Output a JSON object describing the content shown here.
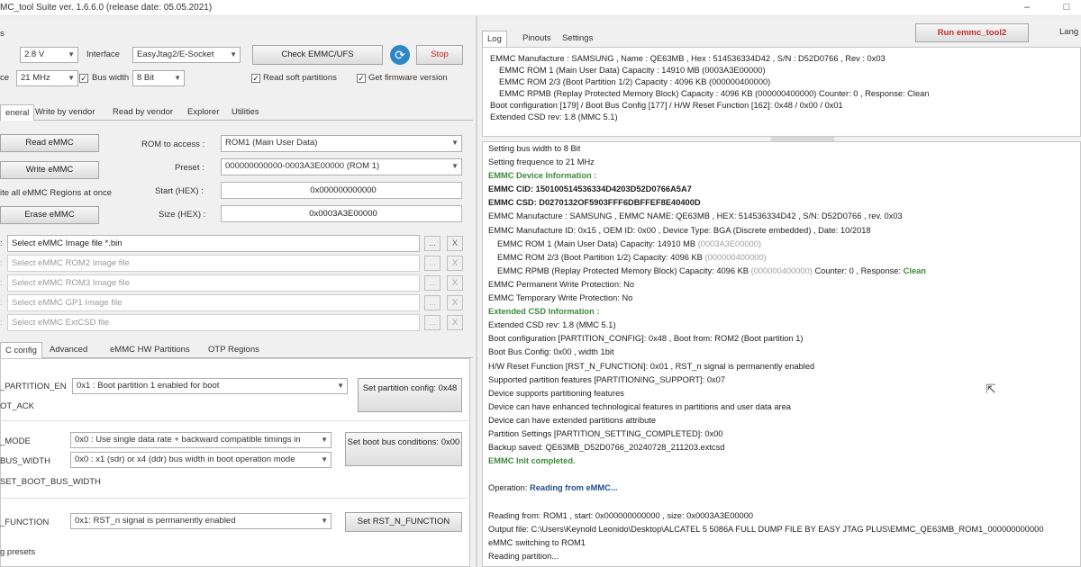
{
  "window": {
    "title": "MC_tool Suite  ver. 1.6.6.0 (release date: 05.05.2021)",
    "minimize": "–",
    "maximize": "□"
  },
  "top_controls": {
    "voltage": "2.8 V",
    "interface_label": "Interface",
    "interface_value": "EasyJtag2/E-Socket",
    "freq_label": "ce",
    "freq": "21 MHz",
    "bus_width_label": "Bus width",
    "bus_width": "8 Bit",
    "check_button": "Check EMMC/UFS",
    "stop_button": "Stop",
    "read_soft_partitions": "Read soft partitions",
    "get_firmware": "Get firmware version"
  },
  "main_tabs": [
    "eneral",
    "Write by vendor",
    "Read by vendor",
    "Explorer",
    "Utilities"
  ],
  "general": {
    "read_button": "Read eMMC",
    "write_button": "Write eMMC",
    "write_all_label": "ite all eMMC Regions at once",
    "erase_button": "Erase eMMC",
    "rom_label": "ROM to access :",
    "rom_value": "ROM1 (Main User Data)",
    "preset_label": "Preset :",
    "preset_value": "000000000000-0003A3E00000 (ROM 1)",
    "start_label": "Start (HEX) :",
    "start_value": "0x000000000000",
    "size_label": "Size (HEX) :",
    "size_value": "0x0003A3E00000",
    "files": [
      "Select eMMC Image file *.bin",
      "Select eMMC ROM2 Image file",
      "Select eMMC ROM3 Image file",
      "Select eMMC GP1 Image file",
      "Select eMMC ExtCSD file"
    ],
    "browse": "...",
    "clear": "X"
  },
  "config_tabs": [
    "C config",
    "Advanced",
    "eMMC HW Partitions",
    "OTP Regions"
  ],
  "config": {
    "partition_label": "_PARTITION_EN",
    "partition_value": "0x1 : Boot partition 1 enabled for boot",
    "boot_ack_label": "OT_ACK",
    "set_partition_button": "Set partition config: 0x48",
    "mode_label": "_MODE",
    "mode_value": "0x0 : Use single data rate + backward compatible timings in",
    "bus_width_label": "BUS_WIDTH",
    "bus_width_value": "0x0 : x1 (sdr) or x4 (ddr) bus width in boot operation mode",
    "set_boot_bus_button": "Set boot bus conditions: 0x00",
    "reset_boot_label": "SET_BOOT_BUS_WIDTH",
    "rst_label": "_FUNCTION",
    "rst_value": "0x1: RST_n signal is permanently enabled",
    "set_rst_button": "Set RST_N_FUNCTION",
    "presets_label": "g presets"
  },
  "right_tabs": [
    "Log",
    "Pinouts",
    "Settings"
  ],
  "run_button": "Run emmc_tool2",
  "lang_label": "Lang",
  "summary": [
    "EMMC Manufacture : SAMSUNG , Name : QE63MB , Hex : 514536334D42 , S/N : D52D0766 , Rev : 0x03",
    "EMMC ROM 1 (Main User Data) Capacity : 14910 MB (0003A3E00000)",
    "EMMC ROM 2/3 (Boot Partition 1/2) Capacity : 4096 KB (000000400000)",
    "EMMC RPMB (Replay Protected Memory Block) Capacity : 4096 KB (000000400000) Counter: 0 , Response: Clean",
    "Boot configuration [179] / Boot Bus Config [177] / H/W Reset Function [162]: 0x48 / 0x00 / 0x01",
    "Extended CSD rev: 1.8 (MMC 5.1)"
  ],
  "log": {
    "l1": "Setting bus width to 8 Bit",
    "l2": "Setting frequence to 21 MHz",
    "l3": "EMMC Device Information :",
    "l4": "EMMC CID: 150100514536334D4203D52D0766A5A7",
    "l5": "EMMC CSD: D0270132OF5903FFF6DBFFEF8E40400D",
    "l6": "EMMC Manufacture : SAMSUNG , EMMC NAME: QE63MB , HEX: 514536334D42 , S/N: D52D0766 , rev. 0x03",
    "l7": "EMMC Manufacture ID: 0x15 , OEM ID: 0x00 , Device Type: BGA (Discrete embedded) , Date: 10/2018",
    "l8a": "EMMC ROM 1 (Main User Data) Capacity: 14910 MB",
    "l8b": "(0003A3E00000)",
    "l9a": "EMMC ROM 2/3 (Boot Partition 1/2) Capacity: 4096 KB",
    "l9b": "(000000400000)",
    "l10a": "EMMC RPMB (Replay Protected Memory Block) Capacity: 4096 KB",
    "l10b": "(000000400000)",
    "l10c": "Counter: 0 , Response:",
    "l10d": "Clean",
    "l11": "EMMC Permanent Write Protection: No",
    "l12": "EMMC Temporary Write Protection: No",
    "l13": "Extended CSD Information :",
    "l14": "Extended CSD rev: 1.8 (MMC 5.1)",
    "l15": "Boot configuration [PARTITION_CONFIG]: 0x48 , Boot from: ROM2 (Boot partition 1)",
    "l16": "Boot Bus Config: 0x00 , width 1bit",
    "l17": "H/W Reset Function [RST_N_FUNCTION]: 0x01 , RST_n signal is permanently enabled",
    "l18": "Supported partition features [PARTITIONING_SUPPORT]: 0x07",
    "l19": "Device supports partitioning features",
    "l20": "Device can have enhanced technological features in partitions and user data area",
    "l21": "Device can have extended partitions attribute",
    "l22": "Partition Settings [PARTITION_SETTING_COMPLETED]: 0x00",
    "l23": "Backup saved: QE63MB_D52D0766_20240728_211203.extcsd",
    "l24": "EMMC Init completed.",
    "l25a": "Operation:",
    "l25b": "Reading from eMMC...",
    "l26": "Reading from: ROM1 , start: 0x000000000000 , size: 0x0003A3E00000",
    "l27": "Output file: C:\\Users\\Keynold Leonido\\Desktop\\ALCATEL 5 5086A FULL DUMP FILE BY EASY JTAG PLUS\\EMMC_QE63MB_ROM1_000000000000",
    "l28": "eMMC switching to ROM1",
    "l29": "Reading partition..."
  },
  "colors": {
    "green": "#3c8a3c",
    "blue": "#1f4f8a",
    "stop_red": "#cc2222"
  }
}
